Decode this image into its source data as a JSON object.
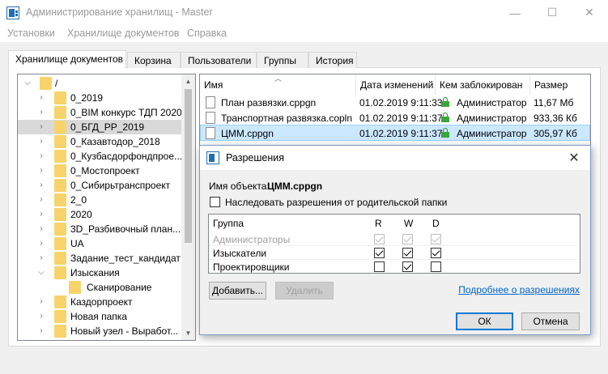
{
  "window": {
    "title": "Администрирование хранилищ - Master",
    "minimize": "—",
    "maximize": "☐",
    "close": "✕"
  },
  "menu": [
    "Установки",
    "Хранилище документов",
    "Справка"
  ],
  "tabs": [
    "Хранилище документов",
    "Корзина",
    "Пользователи",
    "Группы",
    "История"
  ],
  "tree": {
    "root": "/",
    "items": [
      {
        "label": "0_2019"
      },
      {
        "label": "0_BIM конкурс ТДП 2020"
      },
      {
        "label": "0_БГД_РР_2019"
      },
      {
        "label": "0_Казавтодор_2018"
      },
      {
        "label": "0_Кузбасдорфондпрое..."
      },
      {
        "label": "0_Мостопроект"
      },
      {
        "label": "0_Сибирьтранспроект"
      },
      {
        "label": "2_0"
      },
      {
        "label": "2020"
      },
      {
        "label": "3D_Разбивочный план..."
      },
      {
        "label": "UA"
      },
      {
        "label": "Задание_тест_кандидат"
      },
      {
        "label": "Изыскания"
      },
      {
        "label": "Сканирование"
      },
      {
        "label": "Каздорпроект"
      },
      {
        "label": "Новая папка"
      },
      {
        "label": "Новый узел - Выработ..."
      }
    ]
  },
  "filelist": {
    "columns": [
      "Имя",
      "Дата изменений",
      "Кем заблокирован",
      "Размер"
    ],
    "rows": [
      {
        "name": "План развязки.cppgn",
        "date": "01.02.2019 9:11:33",
        "locked_by": "Администратор",
        "size": "11,67 Мб"
      },
      {
        "name": "Транспортная развязка.copln",
        "date": "01.02.2019 9:11:37",
        "locked_by": "Администратор",
        "size": "933,36 Кб"
      },
      {
        "name": "ЦММ.cppgn",
        "date": "01.02.2019 9:11:37",
        "locked_by": "Администратор",
        "size": "305,97 Кб"
      }
    ]
  },
  "dialog": {
    "title": "Разрешения",
    "object_label": "Имя объекта:",
    "object_value": "ЦММ.cppgn",
    "inherit_label": "Наследовать разрешения от родительской папки",
    "inherit_checked": false,
    "grid": {
      "columns": [
        "Группа",
        "R",
        "W",
        "D"
      ],
      "rows": [
        {
          "group": "Администраторы",
          "r": true,
          "w": true,
          "d": true,
          "disabled": true
        },
        {
          "group": "Изыскатели",
          "r": true,
          "w": true,
          "d": true,
          "disabled": false
        },
        {
          "group": "Проектировщики",
          "r": false,
          "w": true,
          "d": false,
          "disabled": false
        }
      ]
    },
    "add_button": "Добавить...",
    "remove_button": "Удалить",
    "more_link": "Подробнее о разрешениях",
    "ok_button": "ОК",
    "cancel_button": "Отмена"
  }
}
